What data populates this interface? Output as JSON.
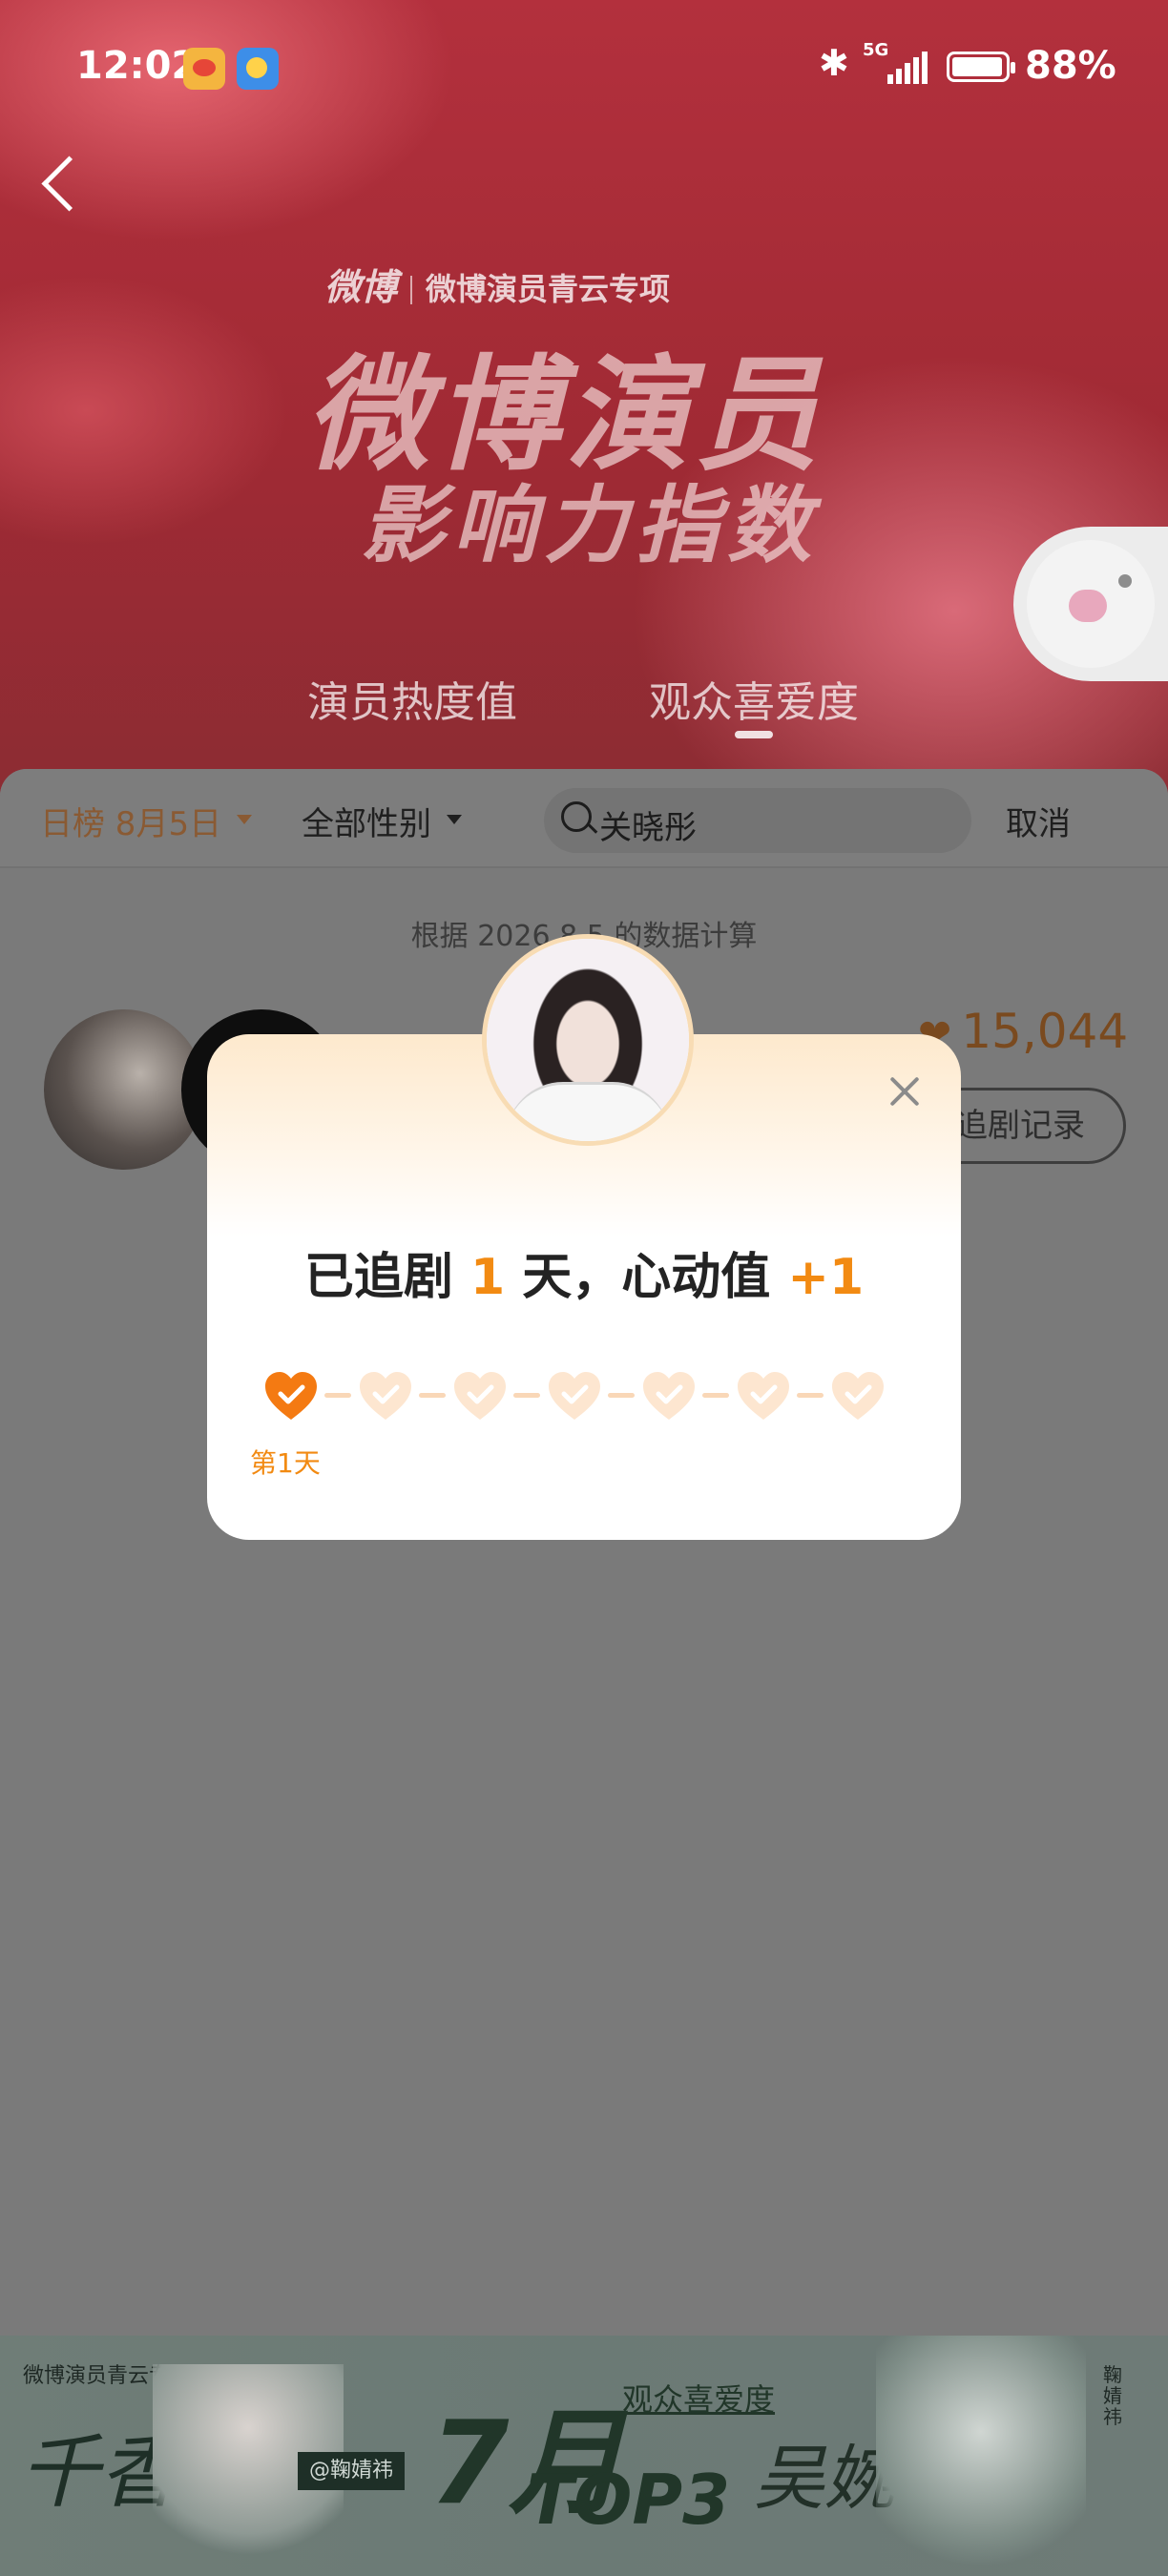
{
  "status_bar": {
    "time": "12:02",
    "network": "5G",
    "battery": "88%"
  },
  "header": {
    "brand": "微博",
    "brand_sub": "微博演员青云专项",
    "title_line1": "微博演员",
    "title_line2": "影响力指数",
    "tabs": [
      {
        "label": "演员热度值",
        "active": false
      },
      {
        "label": "观众喜爱度",
        "active": true
      }
    ]
  },
  "filters": {
    "date_label": "日榜 8月5日",
    "gender_label": "全部性别",
    "search_value": "关晓彤",
    "cancel_label": "取消"
  },
  "list": {
    "calc_note": "根据 2026.8.5 的数据计算",
    "rows": [
      {
        "score": "15,044",
        "record_label": "追剧记录"
      }
    ]
  },
  "modal": {
    "message_prefix": "已追剧",
    "days": "1",
    "message_mid": "天，心动值",
    "points": "+1",
    "total_days": 7,
    "completed_days": 1,
    "day_label": "第1天"
  },
  "banner": {
    "tag": "微博演员青云专项",
    "name_left": "千香",
    "handle": "@鞠婧祎",
    "month": "7月",
    "rank": "TOP3",
    "category": "观众喜爱度",
    "name_right": "吴婉非",
    "side_text": "鞠婧祎"
  },
  "colors": {
    "accent": "#f28a12",
    "hero_red": "#b3303d",
    "overlay": "#7c7c7c"
  }
}
